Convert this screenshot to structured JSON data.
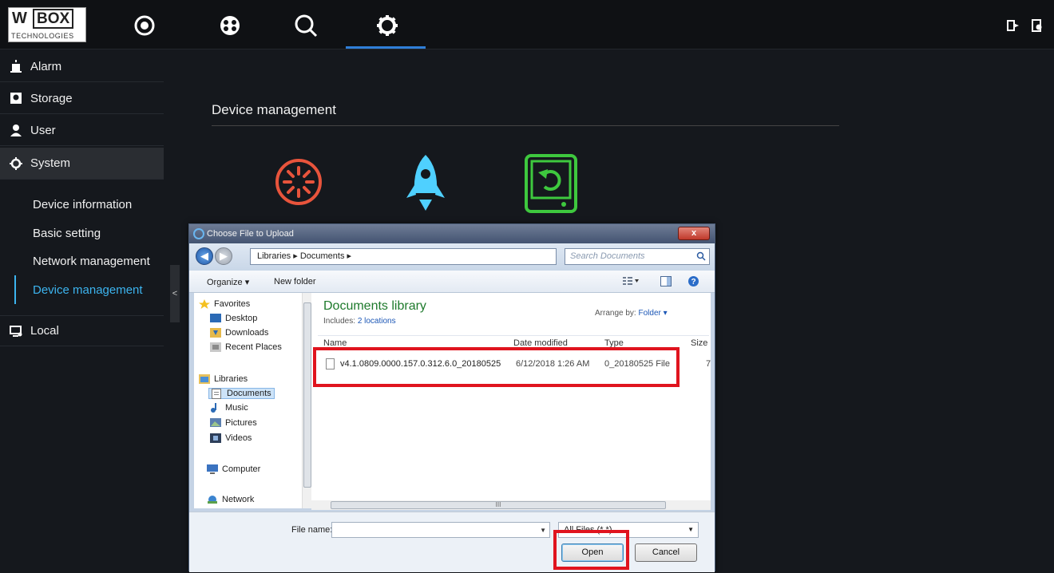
{
  "app": {
    "logo": {
      "main": "W",
      "box": "BOX",
      "sub": "TECHNOLOGIES"
    },
    "nav_icons": [
      "live-view-icon",
      "playback-icon",
      "search-icon",
      "settings-icon"
    ],
    "top_right_icons": [
      "logout-icon",
      "lock-icon"
    ],
    "accent": "#3cb4ef"
  },
  "sidebar": {
    "items": [
      {
        "label": "Alarm",
        "icon": "alarm-icon"
      },
      {
        "label": "Storage",
        "icon": "storage-icon"
      },
      {
        "label": "User",
        "icon": "user-icon"
      },
      {
        "label": "System",
        "icon": "gear-icon"
      },
      {
        "label": "Local",
        "icon": "monitor-icon"
      }
    ],
    "system_sub": [
      "Device information",
      "Basic setting",
      "Network management",
      "Device management"
    ],
    "collapse": "<"
  },
  "main": {
    "title": "Device management",
    "icons": [
      {
        "name": "reboot-icon",
        "color": "#e8543c"
      },
      {
        "name": "upgrade-icon",
        "color": "#4fd0ff"
      },
      {
        "name": "reset-icon",
        "color": "#3ec83e"
      }
    ]
  },
  "dialog": {
    "title": "Choose File to Upload",
    "close": "x",
    "address": "Libraries  ▸  Documents  ▸",
    "search_placeholder": "Search Documents",
    "toolbar": {
      "organize": "Organize ▾",
      "new_folder": "New folder"
    },
    "nav": {
      "favorites": "Favorites",
      "favorites_items": [
        "Desktop",
        "Downloads",
        "Recent Places"
      ],
      "libraries": "Libraries",
      "libraries_items": [
        "Documents",
        "Music",
        "Pictures",
        "Videos"
      ],
      "computer": "Computer",
      "network": "Network"
    },
    "library": {
      "title": "Documents library",
      "includes_label": "Includes:",
      "includes_link": "2 locations",
      "arrange_label": "Arrange by:",
      "arrange_value": "Folder ▾"
    },
    "columns": [
      "Name",
      "Date modified",
      "Type",
      "Size"
    ],
    "files": [
      {
        "name": "v4.1.0809.0000.157.0.312.6.0_20180525",
        "date": "6/12/2018 1:26 AM",
        "type": "0_20180525 File",
        "size": "7"
      }
    ],
    "hscroll_label": "III",
    "file_name_label": "File name:",
    "file_name_value": "",
    "filter": "All Files (*.*)",
    "open_label": "Open",
    "cancel_label": "Cancel"
  },
  "highlight_color": "#e0141e"
}
